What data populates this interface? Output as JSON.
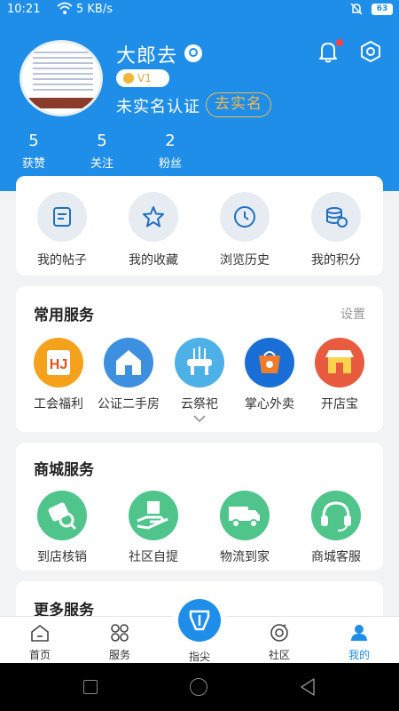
{
  "status_bar": {
    "time": "10:21",
    "speed": "5 KB/s",
    "battery": "63"
  },
  "profile": {
    "username": "大郎去",
    "level": "V1",
    "verification_status": "未实名认证",
    "verify_button": "去实名",
    "stats": [
      {
        "value": "5",
        "label": "获赞"
      },
      {
        "value": "5",
        "label": "关注"
      },
      {
        "value": "2",
        "label": "粉丝"
      }
    ]
  },
  "quick_links": [
    {
      "label": "我的帖子",
      "icon": "post-icon"
    },
    {
      "label": "我的收藏",
      "icon": "star-icon"
    },
    {
      "label": "浏览历史",
      "icon": "clock-icon"
    },
    {
      "label": "我的积分",
      "icon": "coins-icon"
    }
  ],
  "common_services": {
    "title": "常用服务",
    "action": "设置",
    "items": [
      {
        "label": "工会福利",
        "icon": "union-benefit-icon",
        "color": "#f4a21b"
      },
      {
        "label": "公证二手房",
        "icon": "house-icon",
        "color": "#3d8fe0"
      },
      {
        "label": "云祭祀",
        "icon": "memorial-icon",
        "color": "#4db0e6"
      },
      {
        "label": "掌心外卖",
        "icon": "takeout-icon",
        "color": "#1a6fd6"
      },
      {
        "label": "开店宝",
        "icon": "shop-icon",
        "color": "#e85b3e"
      }
    ]
  },
  "mall_services": {
    "title": "商城服务",
    "items": [
      {
        "label": "到店核销",
        "icon": "verify-icon"
      },
      {
        "label": "社区自提",
        "icon": "pickup-icon"
      },
      {
        "label": "物流到家",
        "icon": "truck-icon"
      },
      {
        "label": "商城客服",
        "icon": "headset-icon"
      }
    ]
  },
  "more_services": {
    "title": "更多服务"
  },
  "tab_bar": {
    "tabs": [
      {
        "label": "首页",
        "icon": "home-icon"
      },
      {
        "label": "服务",
        "icon": "grid-icon"
      },
      {
        "label": "指尖",
        "icon": "app-logo-icon"
      },
      {
        "label": "社区",
        "icon": "community-icon"
      },
      {
        "label": "我的",
        "icon": "user-icon"
      }
    ],
    "active": "我的"
  },
  "colors": {
    "primary": "#1f8ee8",
    "accent": "#f7b84b",
    "mall_green": "#4fc58c"
  }
}
